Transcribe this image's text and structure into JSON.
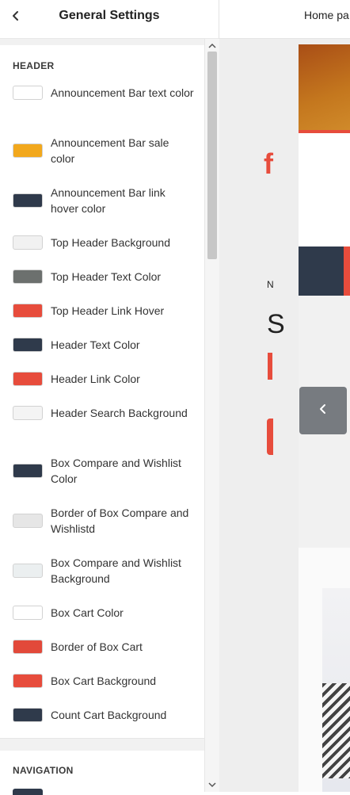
{
  "topbar": {
    "title": "General Settings"
  },
  "sections": {
    "header": {
      "title": "HEADER",
      "items": [
        {
          "label": "Announcement Bar text color",
          "color": "#ffffff"
        },
        {
          "label": "Announcement Bar sale color",
          "color": "#f2a81d"
        },
        {
          "label": "Announcement Bar link hover color",
          "color": "#2f3a4b"
        },
        {
          "label": "Top Header Background",
          "color": "#f1f1f1"
        },
        {
          "label": "Top Header Text Color",
          "color": "#6c706e"
        },
        {
          "label": "Top Header Link Hover",
          "color": "#e74c3c"
        },
        {
          "label": "Header Text Color",
          "color": "#2f3a4b"
        },
        {
          "label": "Header Link Color",
          "color": "#e74c3c"
        },
        {
          "label": "Header Search Background",
          "color": "#f4f4f4"
        },
        {
          "label": "Box Compare and Wishlist Color",
          "color": "#2f3a4b"
        },
        {
          "label": "Border of Box Compare and Wishlistd",
          "color": "#e6e6e6"
        },
        {
          "label": "Box Compare and Wishlist Background",
          "color": "#ebeff0"
        },
        {
          "label": "Box Cart Color",
          "color": "#ffffff"
        },
        {
          "label": "Border of Box Cart",
          "color": "#e2493a"
        },
        {
          "label": "Box Cart Background",
          "color": "#e74c3c"
        },
        {
          "label": "Count Cart Background",
          "color": "#2f3a4b"
        }
      ]
    },
    "navigation": {
      "title": "NAVIGATION",
      "first_color": "#2f3a4b"
    }
  },
  "preview": {
    "tab_label": "Home pa",
    "logo_letter": "f",
    "banner_small": "N",
    "banner_large": "S"
  }
}
